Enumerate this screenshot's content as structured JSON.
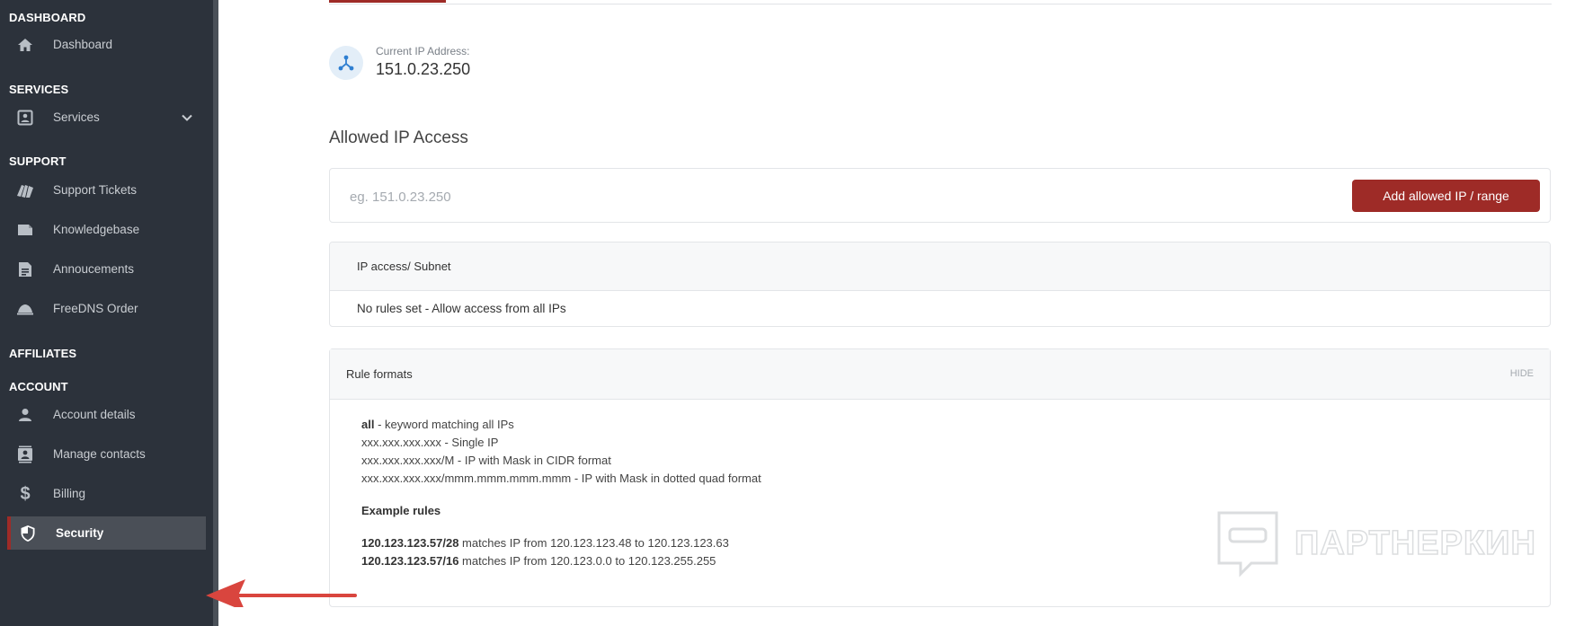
{
  "sidebar": {
    "sections": [
      {
        "heading": "DASHBOARD"
      },
      {
        "heading": "SERVICES"
      },
      {
        "heading": "SUPPORT"
      },
      {
        "heading": "AFFILIATES"
      },
      {
        "heading": "ACCOUNT"
      }
    ],
    "items": [
      {
        "label": "Dashboard",
        "icon": "home-icon"
      },
      {
        "label": "Services",
        "icon": "services-icon",
        "expandable": true
      },
      {
        "label": "Support Tickets",
        "icon": "tickets-icon"
      },
      {
        "label": "Knowledgebase",
        "icon": "knowledgebase-icon"
      },
      {
        "label": "Annoucements",
        "icon": "announcements-icon"
      },
      {
        "label": "FreeDNS Order",
        "icon": "freedns-icon"
      },
      {
        "label": "Account details",
        "icon": "person-icon"
      },
      {
        "label": "Manage contacts",
        "icon": "contacts-icon"
      },
      {
        "label": "Billing",
        "icon": "dollar-icon"
      },
      {
        "label": "Security",
        "icon": "shield-icon",
        "active": true
      }
    ]
  },
  "current_ip": {
    "caption": "Current IP Address:",
    "value": "151.0.23.250"
  },
  "allowed_ip": {
    "title": "Allowed IP Access",
    "input_placeholder": "eg. 151.0.23.250",
    "input_value": "",
    "add_button_label": "Add allowed IP / range"
  },
  "rules_table": {
    "header": "IP access/ Subnet",
    "empty_message": "No rules set - Allow access from all IPs"
  },
  "rule_formats": {
    "title": "Rule formats",
    "hide_label": "HIDE",
    "formats": [
      {
        "pattern": "all",
        "desc": " - keyword matching all IPs"
      },
      {
        "pattern": "xxx.xxx.xxx.xxx",
        "desc": " - Single IP"
      },
      {
        "pattern": "xxx.xxx.xxx.xxx/M",
        "desc": " - IP with Mask in CIDR format"
      },
      {
        "pattern": "xxx.xxx.xxx.xxx/mmm.mmm.mmm.mmm",
        "desc": " - IP with Mask in dotted quad format"
      }
    ],
    "examples_title": "Example rules",
    "examples": [
      {
        "rule": "120.123.123.57/28",
        "desc": " matches IP from 120.123.123.48 to 120.123.123.63"
      },
      {
        "rule": "120.123.123.57/16",
        "desc": " matches IP from 120.123.0.0 to 120.123.255.255"
      }
    ]
  },
  "watermark": {
    "text": "ПАРТНЕРКИН"
  },
  "colors": {
    "sidebar_bg": "#2c323b",
    "accent": "#9e2b27",
    "annotation_arrow": "#d9453e"
  }
}
